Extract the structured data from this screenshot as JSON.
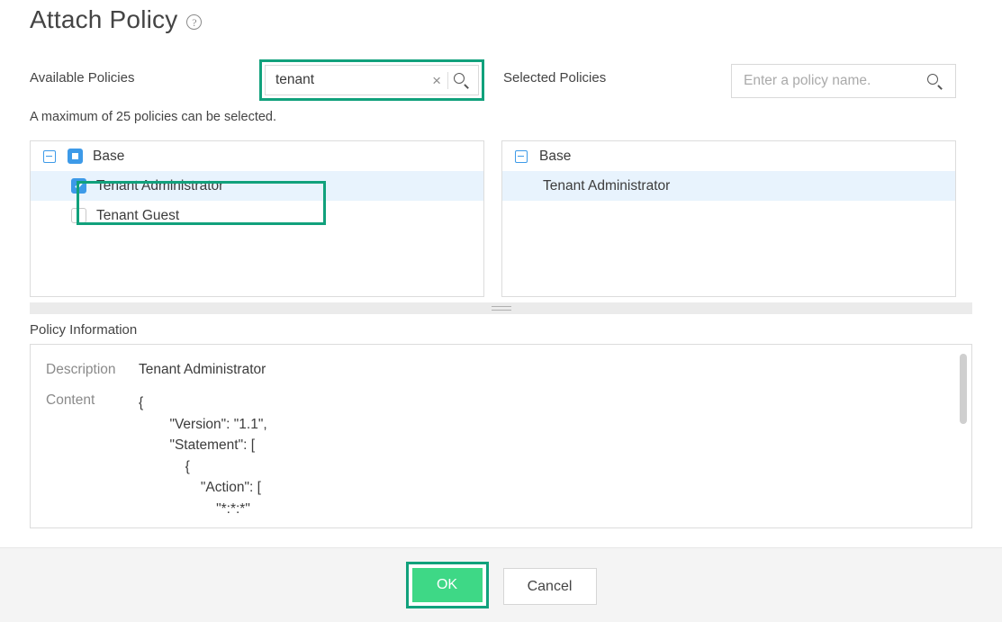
{
  "dialog": {
    "title": "Attach Policy",
    "help_icon": "question-circle-icon"
  },
  "available": {
    "label": "Available Policies",
    "search_value": "tenant",
    "clear_icon": "×",
    "search_icon": "search-icon",
    "note": "A maximum of 25 policies can be selected.",
    "tree": {
      "group_label": "Base",
      "items": [
        {
          "label": "Tenant Administrator",
          "checked": true,
          "selected": true
        },
        {
          "label": "Tenant Guest",
          "checked": false,
          "selected": false
        }
      ]
    }
  },
  "selected": {
    "label": "Selected Policies",
    "search_value": "",
    "search_placeholder": "Enter a policy name.",
    "search_icon": "search-icon",
    "tree": {
      "group_label": "Base",
      "items": [
        {
          "label": "Tenant Administrator",
          "selected": true
        }
      ]
    }
  },
  "policy_information": {
    "label": "Policy Information",
    "description_key": "Description",
    "description_value": "Tenant Administrator",
    "content_key": "Content",
    "content_value": "{\n        \"Version\": \"1.1\",\n        \"Statement\": [\n            {\n                \"Action\": [\n                    \"*:*:*\""
  },
  "footer": {
    "ok_label": "OK",
    "cancel_label": "Cancel"
  },
  "colors": {
    "accent_teal": "#11a17c",
    "ok_green": "#3ed886",
    "checkbox_blue": "#3d9ae8",
    "row_highlight": "#e8f3fd",
    "footer_bg": "#f4f4f4"
  }
}
